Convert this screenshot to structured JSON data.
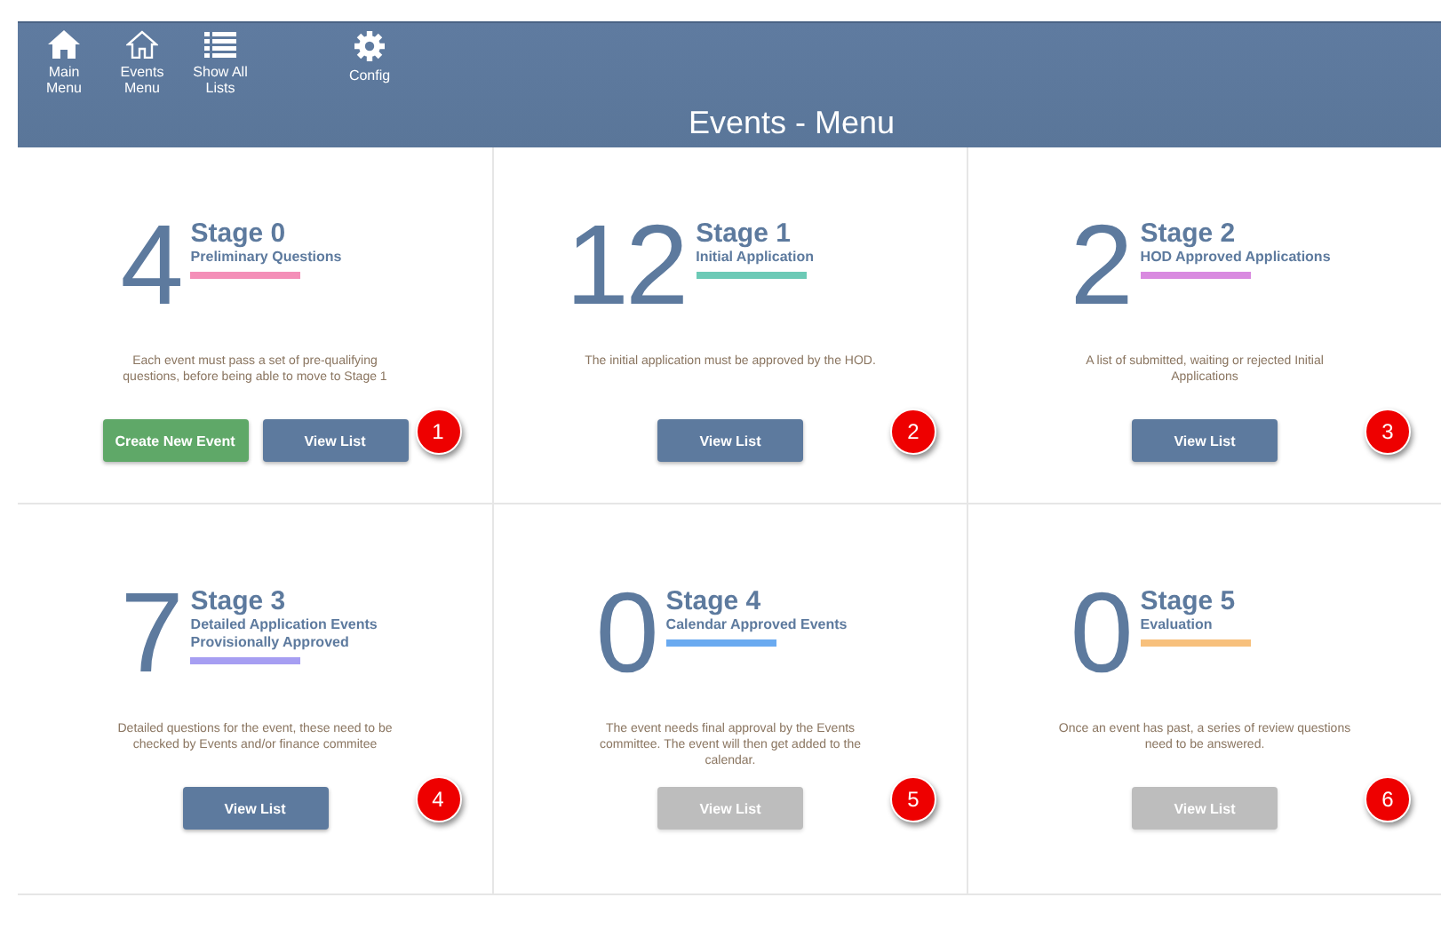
{
  "toolbar": [
    {
      "label": "Main Menu"
    },
    {
      "label": "Events Menu"
    },
    {
      "label": "Show All Lists"
    },
    {
      "label": "Config"
    }
  ],
  "title": "Events - Menu",
  "stages": [
    {
      "count": "4",
      "title": "Stage 0",
      "subtitle": "Preliminary Questions",
      "color": "#f48fb8",
      "description": "Each event must pass a set of pre-qualifying questions, before being able to move to Stage 1",
      "buttons": [
        {
          "label": "Create New Event",
          "kind": "success",
          "disabled": false
        },
        {
          "label": "View List",
          "kind": "primary",
          "disabled": false
        }
      ],
      "badge": "1"
    },
    {
      "count": "12",
      "title": "Stage 1",
      "subtitle": "Initial Application",
      "color": "#6ccab6",
      "description": "The initial application must be approved by the HOD.",
      "buttons": [
        {
          "label": "View List",
          "kind": "primary",
          "disabled": false
        }
      ],
      "badge": "2"
    },
    {
      "count": "2",
      "title": "Stage 2",
      "subtitle": "HOD Approved Applications",
      "color": "#d98ae0",
      "description": "A list of submitted, waiting or rejected Initial Applications",
      "buttons": [
        {
          "label": "View List",
          "kind": "primary",
          "disabled": false
        }
      ],
      "badge": "3"
    },
    {
      "count": "7",
      "title": "Stage 3",
      "subtitle": "Detailed Application Events Provisionally Approved",
      "color": "#a69ef2",
      "description": "Detailed questions for the event, these need to be checked by Events and/or finance commitee",
      "buttons": [
        {
          "label": "View List",
          "kind": "primary",
          "disabled": false
        }
      ],
      "badge": "4"
    },
    {
      "count": "0",
      "title": "Stage 4",
      "subtitle": "Calendar Approved Events",
      "color": "#6aaaf0",
      "description": "The event needs final approval by the Events committee. The event will then get added to the calendar.",
      "buttons": [
        {
          "label": "View List",
          "kind": "primary",
          "disabled": true
        }
      ],
      "badge": "5"
    },
    {
      "count": "0",
      "title": "Stage 5",
      "subtitle": "Evaluation",
      "color": "#f7c07c",
      "description": "Once an event has past, a series of review questions need to be answered.",
      "buttons": [
        {
          "label": "View List",
          "kind": "primary",
          "disabled": true
        }
      ],
      "badge": "6"
    }
  ]
}
